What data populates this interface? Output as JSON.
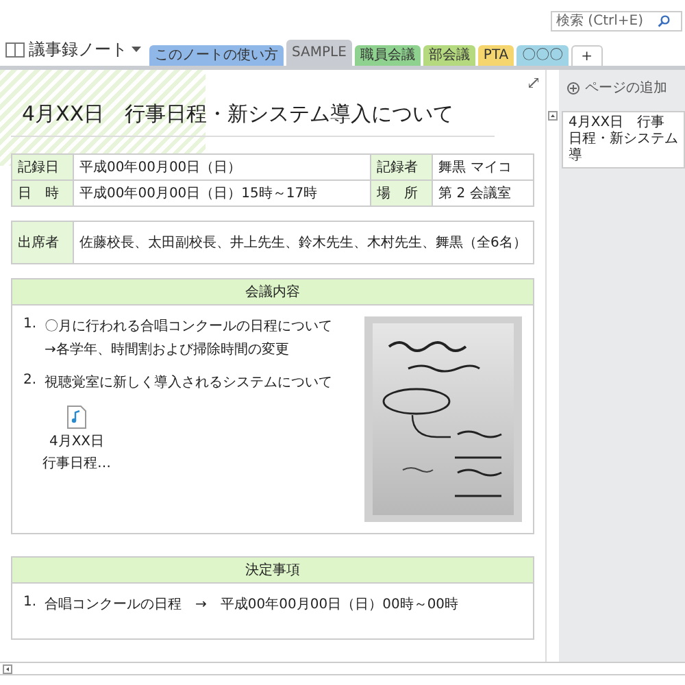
{
  "notebook": {
    "title": "議事録ノート"
  },
  "sections": [
    {
      "label": "このノートの使い方",
      "color": "#8fb8e8",
      "selected": false
    },
    {
      "label": "SAMPLE",
      "color": "#c8ccd2",
      "selected": true
    },
    {
      "label": "職員会議",
      "color": "#8fd18f",
      "selected": false
    },
    {
      "label": "部会議",
      "color": "#b5d97f",
      "selected": false
    },
    {
      "label": "PTA",
      "color": "#f5d66e",
      "selected": false
    },
    {
      "label": "〇〇〇",
      "color": "#9fd3e6",
      "selected": false
    }
  ],
  "new_section_tab": "+",
  "search": {
    "placeholder": "検索 (Ctrl+E)"
  },
  "page": {
    "title": "4月XX日　行事日程・新システム導入について",
    "info": [
      [
        {
          "label": "記録日",
          "value": "平成00年00月00日（日）"
        },
        {
          "label": "記録者",
          "value": "舞黒 マイコ"
        }
      ],
      [
        {
          "label": "日　時",
          "value": "平成00年00月00日（日）15時～17時"
        },
        {
          "label": "場　所",
          "value": "第 2 会議室"
        }
      ]
    ],
    "attendees": {
      "label": "出席者",
      "value": "佐藤校長、太田副校長、井上先生、鈴木先生、木村先生、舞黒（全6名）"
    },
    "agenda": {
      "heading": "会議内容",
      "items": [
        {
          "number": "1.",
          "lines": [
            "〇月に行われる合唱コンクールの日程について",
            "→各学年、時間割および掃除時間の変更"
          ]
        },
        {
          "number": "2.",
          "lines": [
            "視聴覚室に新しく導入されるシステムについて"
          ]
        }
      ],
      "attachment": {
        "name_lines": [
          "4月XX日",
          "行事日程…"
        ]
      }
    },
    "decisions": {
      "heading": "決定事項",
      "items": [
        {
          "number": "1.",
          "text": "合唱コンクールの日程　→　平成00年00月00日（日）00時～00時"
        }
      ]
    }
  },
  "sidebar": {
    "add_page": "ページの追加",
    "pages": [
      {
        "title": "4月XX日　行事日程・新システム導",
        "selected": true
      }
    ]
  }
}
